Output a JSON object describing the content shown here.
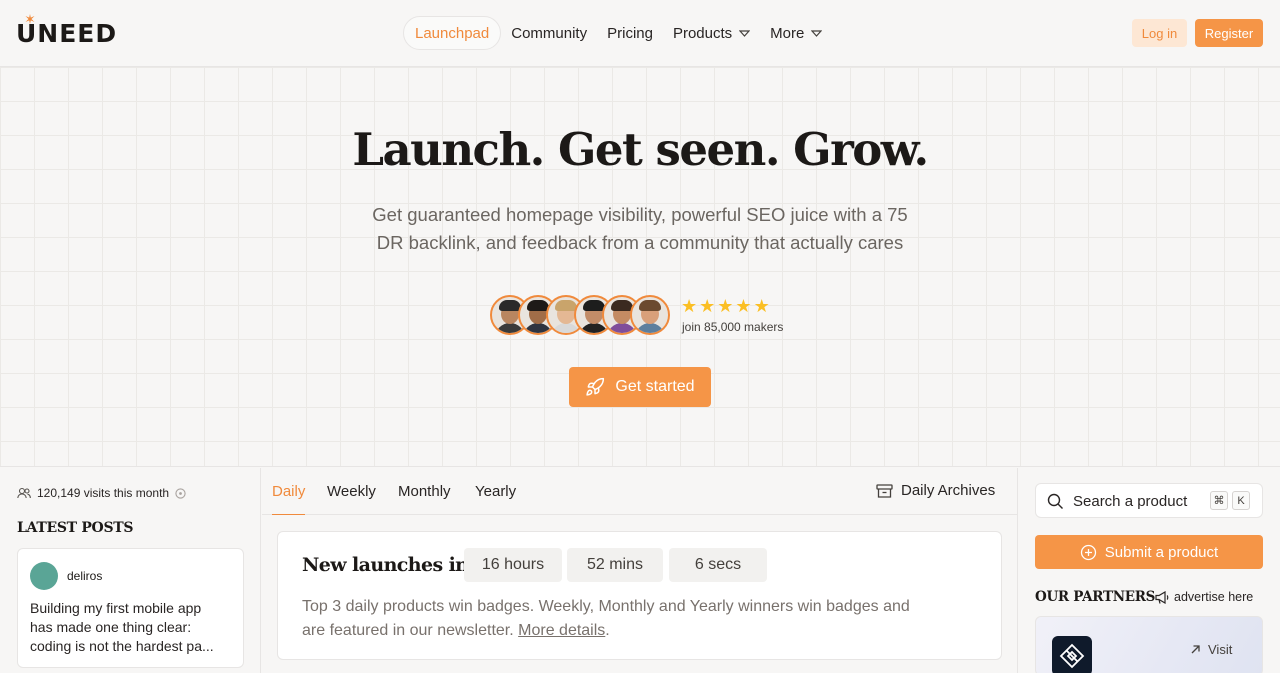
{
  "brand": {
    "logo_text": "UNEED",
    "accent_color": "#f59547"
  },
  "nav": {
    "items": [
      {
        "label": "Launchpad",
        "active": true
      },
      {
        "label": "Community"
      },
      {
        "label": "Pricing"
      },
      {
        "label": "Products",
        "has_dropdown": true
      },
      {
        "label": "More",
        "has_dropdown": true
      }
    ],
    "login_label": "Log in",
    "register_label": "Register"
  },
  "hero": {
    "title": "Launch. Get seen. Grow.",
    "subtitle_line1": "Get guaranteed homepage visibility, powerful SEO juice with a 75",
    "subtitle_line2": "DR backlink, and feedback from a community that actually cares",
    "rating_stars": 5,
    "makers_text": "join 85,000 makers",
    "cta_label": "Get started",
    "avatars": [
      {
        "skin": "#b98660",
        "hair": "#2a2a2a",
        "shirt": "#3a3a3a"
      },
      {
        "skin": "#a16d48",
        "hair": "#1e1a18",
        "shirt": "#2f3440"
      },
      {
        "skin": "#e4b894",
        "hair": "#c9a46b",
        "shirt": "#d9d9d9"
      },
      {
        "skin": "#c28c68",
        "hair": "#1d1d1d",
        "shirt": "#222222"
      },
      {
        "skin": "#c48b63",
        "hair": "#3b2a20",
        "shirt": "#7f4e9a"
      },
      {
        "skin": "#d9a07a",
        "hair": "#6b4a2f",
        "shirt": "#5d7f9e"
      }
    ]
  },
  "left": {
    "visits_text": "120,149 visits this month",
    "latest_posts_heading": "LATEST POSTS",
    "post": {
      "user": "deliros",
      "text_line1": "Building my first mobile app",
      "text_line2": "has made one thing clear:",
      "text_line3": "coding is not the hardest pa..."
    }
  },
  "center": {
    "tabs": [
      {
        "label": "Daily",
        "active": true
      },
      {
        "label": "Weekly"
      },
      {
        "label": "Monthly"
      },
      {
        "label": "Yearly"
      }
    ],
    "archives_label": "Daily Archives",
    "launch": {
      "title": "New launches in",
      "hours": "16 hours",
      "mins": "52 mins",
      "secs": "6 secs",
      "desc_line1": "Top 3 daily products win badges. Weekly, Monthly and Yearly winners win badges and",
      "desc_line2_pre": "are featured in our newsletter.",
      "more_details": "More details",
      "desc_line2_post": "."
    }
  },
  "right": {
    "search_placeholder": "Search a product",
    "kbd_cmd": "⌘",
    "kbd_k": "K",
    "submit_label": "Submit a product",
    "partners_heading": "OUR PARTNERS",
    "advertise_label": "advertise here",
    "visit_label": "Visit"
  }
}
